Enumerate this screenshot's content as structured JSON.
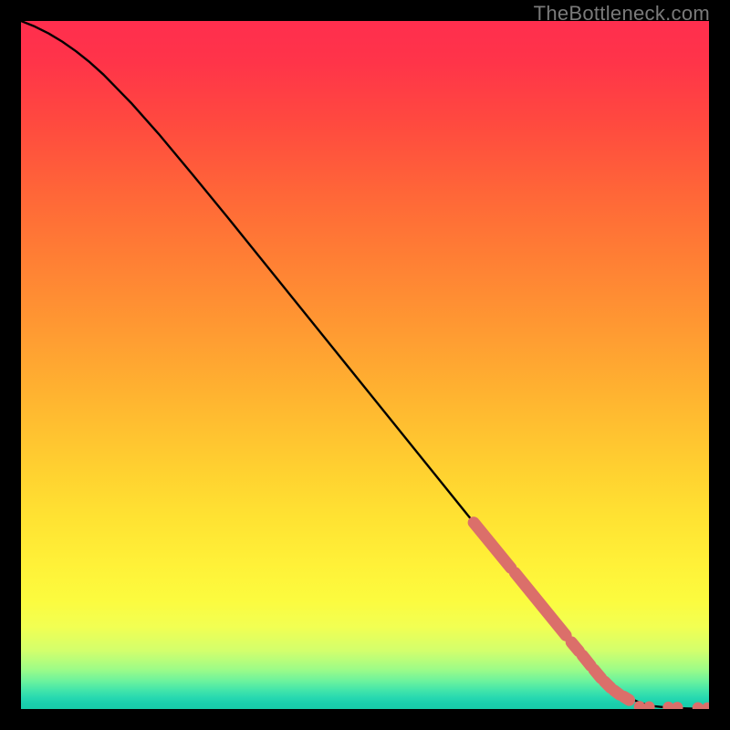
{
  "watermark": "TheBottleneck.com",
  "colors": {
    "gradient": [
      {
        "offset": 0.0,
        "hex": "#ff2e4e"
      },
      {
        "offset": 0.06,
        "hex": "#ff3449"
      },
      {
        "offset": 0.15,
        "hex": "#ff4a3f"
      },
      {
        "offset": 0.25,
        "hex": "#ff6638"
      },
      {
        "offset": 0.35,
        "hex": "#ff8034"
      },
      {
        "offset": 0.45,
        "hex": "#ff9a32"
      },
      {
        "offset": 0.55,
        "hex": "#ffb530"
      },
      {
        "offset": 0.65,
        "hex": "#ffd030"
      },
      {
        "offset": 0.72,
        "hex": "#ffe232"
      },
      {
        "offset": 0.79,
        "hex": "#fff138"
      },
      {
        "offset": 0.84,
        "hex": "#fcfb3e"
      },
      {
        "offset": 0.88,
        "hex": "#f2ff52"
      },
      {
        "offset": 0.915,
        "hex": "#d3ff6c"
      },
      {
        "offset": 0.942,
        "hex": "#9efc87"
      },
      {
        "offset": 0.96,
        "hex": "#6af29e"
      },
      {
        "offset": 0.974,
        "hex": "#3fe4ab"
      },
      {
        "offset": 0.984,
        "hex": "#26d8b0"
      },
      {
        "offset": 0.992,
        "hex": "#1acfad"
      },
      {
        "offset": 1.0,
        "hex": "#18cca9"
      }
    ],
    "line": "#000000",
    "marker": "#db6f6a"
  },
  "chart_data": {
    "type": "line",
    "title": "",
    "xlabel": "",
    "ylabel": "",
    "xlim": [
      0,
      100
    ],
    "ylim": [
      0,
      100
    ],
    "series": [
      {
        "name": "curve",
        "style": "solid",
        "x": [
          0,
          2,
          4,
          6,
          8,
          10,
          12,
          16,
          20,
          25,
          30,
          35,
          40,
          45,
          50,
          55,
          60,
          65,
          70,
          75,
          80,
          84,
          86,
          88,
          90,
          91,
          92,
          93,
          94,
          95,
          96,
          97,
          98,
          99,
          100
        ],
        "y": [
          100.0,
          99.2,
          98.2,
          97.0,
          95.6,
          94.0,
          92.2,
          88.1,
          83.6,
          77.6,
          71.5,
          65.3,
          59.1,
          52.9,
          46.7,
          40.5,
          34.3,
          28.1,
          22.0,
          15.8,
          9.7,
          4.9,
          3.1,
          1.8,
          0.9,
          0.6,
          0.4,
          0.3,
          0.2,
          0.15,
          0.11,
          0.08,
          0.05,
          0.03,
          0.02
        ]
      },
      {
        "name": "highlight-segments",
        "style": "thick-markers",
        "segments": [
          {
            "x": [
              65.8,
              71.2
            ],
            "y": [
              27.1,
              20.5
            ]
          },
          {
            "x": [
              71.8,
              79.2
            ],
            "y": [
              19.8,
              10.7
            ]
          },
          {
            "x": [
              80.0,
              81.1
            ],
            "y": [
              9.7,
              8.4
            ]
          },
          {
            "x": [
              81.6,
              82.8
            ],
            "y": [
              7.8,
              6.3
            ]
          },
          {
            "x": [
              83.3,
              84.3
            ],
            "y": [
              5.7,
              4.5
            ]
          },
          {
            "x": [
              84.8,
              85.7
            ],
            "y": [
              4.0,
              3.1
            ]
          },
          {
            "x": [
              86.2,
              87.0
            ],
            "y": [
              2.7,
              2.1
            ]
          },
          {
            "x": [
              87.6,
              88.4
            ],
            "y": [
              1.8,
              1.3
            ]
          }
        ]
      },
      {
        "name": "tail-dots",
        "style": "dots",
        "points": [
          {
            "x": 89.9,
            "y": 0.35
          },
          {
            "x": 91.3,
            "y": 0.3
          },
          {
            "x": 94.1,
            "y": 0.25
          },
          {
            "x": 95.4,
            "y": 0.22
          },
          {
            "x": 98.4,
            "y": 0.18
          },
          {
            "x": 99.8,
            "y": 0.15
          }
        ]
      }
    ]
  }
}
